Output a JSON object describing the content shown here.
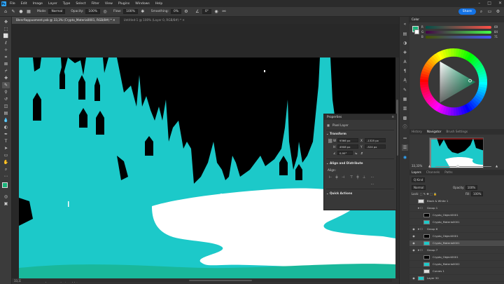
{
  "menu": {
    "logo": "Ps",
    "items": [
      "File",
      "Edit",
      "Image",
      "Layer",
      "Type",
      "Select",
      "Filter",
      "View",
      "Plugins",
      "Windows",
      "Help"
    ]
  },
  "options": {
    "mode_label": "Mode:",
    "mode_value": "Normal",
    "opacity_label": "Opacity:",
    "opacity_value": "100%",
    "flow_label": "Flow:",
    "flow_value": "100%",
    "smoothing_label": "Smoothing:",
    "smoothing_value": "0%",
    "angle_value": "0°",
    "share_label": "Share"
  },
  "tabs": [
    {
      "label": "BlenrRappuoment.psb @ 33,3% (Crypto_Materia0001, RGB/8#) *",
      "active": true
    },
    {
      "label": "Untitled-1 @ 100% (Layer 0, RGB/8#) *",
      "active": false
    }
  ],
  "status": {
    "zoom": "33,33%",
    "doc": "13366 px x 3868 px (300 ppi)"
  },
  "properties": {
    "title": "Properties",
    "layer_type": "Pixel Layer",
    "transform_label": "Transform",
    "w_label": "W",
    "w_value": "9366 px",
    "h_label": "H",
    "h_value": "4908 px",
    "x_label": "X",
    "x_value": "-1325 px",
    "y_label": "Y",
    "y_value": "-524 px",
    "angle_value": "0,00°",
    "align_label": "Align and Distribute",
    "align_sub": "Align:",
    "quick_label": "Quick Actions"
  },
  "color_panel": {
    "tab": "Color",
    "r_label": "R",
    "r_value": "69",
    "g_label": "G",
    "g_value": "84",
    "b_label": "B",
    "b_value": "71",
    "accent": "#1bb37a"
  },
  "nav_panel": {
    "tabs": [
      "History",
      "Navigator",
      "Brush Settings"
    ],
    "zoom": "33,33%"
  },
  "layers_panel": {
    "tabs": [
      "Layers",
      "Channels",
      "Paths"
    ],
    "search_placeholder": "Q Kind",
    "blend": "Normal",
    "opacity_label": "Opacity:",
    "opacity_value": "100%",
    "lock_label": "Lock:",
    "fill_label": "Fill:",
    "fill_value": "100%",
    "rows": [
      {
        "name": "Black & White 1",
        "kind": "adj",
        "indent": 0,
        "eye": false,
        "sel": false
      },
      {
        "name": "Group 1",
        "kind": "group",
        "indent": 0,
        "eye": false,
        "sel": false
      },
      {
        "name": "Crypto_Object0001",
        "kind": "mask",
        "indent": 1,
        "eye": false,
        "sel": false
      },
      {
        "name": "Crypto_Materia0001",
        "kind": "cyan",
        "indent": 1,
        "eye": false,
        "sel": false
      },
      {
        "name": "Group 6",
        "kind": "group",
        "indent": 0,
        "eye": true,
        "sel": false
      },
      {
        "name": "Crypto_Object0001",
        "kind": "mask",
        "indent": 1,
        "eye": true,
        "sel": false
      },
      {
        "name": "Crypto_Materia0001",
        "kind": "cyan",
        "indent": 1,
        "eye": true,
        "sel": true
      },
      {
        "name": "Group 7",
        "kind": "group",
        "indent": 0,
        "eye": true,
        "sel": false
      },
      {
        "name": "Crypto_Object0001",
        "kind": "mask",
        "indent": 1,
        "eye": false,
        "sel": false
      },
      {
        "name": "Crypto_Materia0002",
        "kind": "cyan",
        "indent": 1,
        "eye": false,
        "sel": false
      },
      {
        "name": "Curves 1",
        "kind": "adj",
        "indent": 1,
        "eye": false,
        "sel": false
      },
      {
        "name": "Layer 30",
        "kind": "cyan",
        "indent": 0,
        "eye": true,
        "sel": false
      }
    ]
  }
}
